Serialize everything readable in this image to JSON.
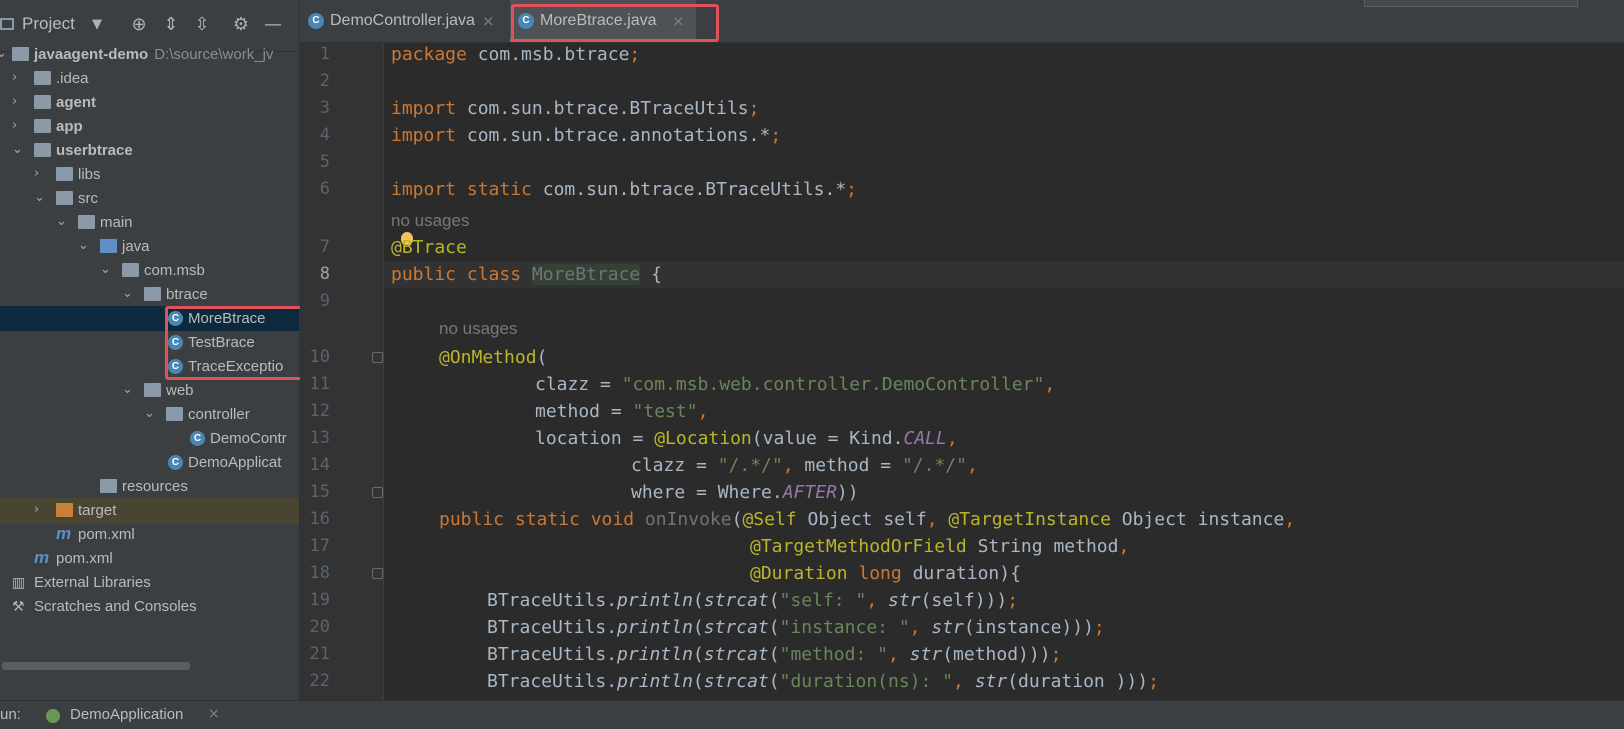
{
  "project_panel": {
    "title": "Project",
    "tree": {
      "root": {
        "label": "javaagent-demo",
        "path": "D:\\source\\work_jv"
      },
      "idea": ".idea",
      "agent": "agent",
      "app": "app",
      "userbtrace": "userbtrace",
      "libs": "libs",
      "src": "src",
      "main": "main",
      "java": "java",
      "com_msb": "com.msb",
      "btrace": "btrace",
      "more_btrace": "MoreBtrace",
      "test_brace": "TestBrace",
      "trace_exception": "TraceExceptio",
      "web": "web",
      "controller": "controller",
      "demo_controller": "DemoContr",
      "demo_application": "DemoApplicat",
      "resources": "resources",
      "target": "target",
      "pom_inner": "pom.xml",
      "pom_root": "pom.xml",
      "external_libraries": "External Libraries",
      "scratches": "Scratches and Consoles"
    }
  },
  "tabs": [
    {
      "label": "DemoController.java"
    },
    {
      "label": "MoreBtrace.java",
      "active": true
    }
  ],
  "editor": {
    "line_numbers": [
      "1",
      "2",
      "3",
      "4",
      "5",
      "6",
      "7",
      "8",
      "9",
      "10",
      "11",
      "12",
      "13",
      "14",
      "15",
      "16",
      "17",
      "18",
      "19",
      "20",
      "21",
      "22"
    ],
    "current_line": "8",
    "hints": {
      "no_usages_1": "no usages",
      "no_usages_2": "no usages"
    },
    "code": {
      "l1_kw": "package",
      "l1_rest": " com.msb.btrace",
      "l1_semi": ";",
      "l3_kw": "import",
      "l3_rest": " com.sun.btrace.BTraceUtils",
      "l3_semi": ";",
      "l4_kw": "import",
      "l4_rest": " com.sun.btrace.annotations.*",
      "l4_semi": ";",
      "l6_kw": "import static",
      "l6_rest": " com.sun.btrace.BTraceUtils.*",
      "l6_semi": ";",
      "l7_ann": "@BTrace",
      "l8_kw": "public class ",
      "l8_cls": "MoreBtrace",
      "l8_rest": " {",
      "l10_ann": "@OnMethod",
      "l10_rest": "(",
      "l11_a": "clazz = ",
      "l11_str": "\"com.msb.web.controller.DemoController\"",
      "l11_semi": ",",
      "l12_a": "method = ",
      "l12_str": "\"test\"",
      "l12_semi": ",",
      "l13_a": "location = ",
      "l13_ann": "@Location",
      "l13_b": "(value = Kind.",
      "l13_const": "CALL",
      "l13_semi": ",",
      "l14_a": "clazz = ",
      "l14_str1": "\"/.*/\"",
      "l14_semi1": ",",
      "l14_b": " method = ",
      "l14_str2": "\"/.*/\"",
      "l14_semi2": ",",
      "l15_a": "where = Where.",
      "l15_const": "AFTER",
      "l15_b": "))",
      "l16_kw": "public static void ",
      "l16_fn": "onInvoke",
      "l16_b": "(",
      "l16_ann1": "@Self",
      "l16_c": " Object self",
      "l16_semi1": ",",
      "l16_ann2": " @TargetInstance",
      "l16_d": " Object instance",
      "l16_semi2": ",",
      "l17_ann": "@TargetMethodOrField",
      "l17_a": " String method",
      "l17_semi": ",",
      "l18_ann": "@Duration",
      "l18_kw": " long",
      "l18_a": " duration){",
      "l19_a": "BTraceUtils.",
      "l19_m": "println",
      "l19_b": "(",
      "l19_m2": "strcat",
      "l19_c": "(",
      "l19_str": "\"self: \"",
      "l19_semi": ",",
      "l19_m3": " str",
      "l19_d": "(self)))",
      "l19_end": ";",
      "l20_a": "BTraceUtils.",
      "l20_m": "println",
      "l20_b": "(",
      "l20_m2": "strcat",
      "l20_c": "(",
      "l20_str": "\"instance: \"",
      "l20_semi": ",",
      "l20_m3": " str",
      "l20_d": "(instance)))",
      "l20_end": ";",
      "l21_a": "BTraceUtils.",
      "l21_m": "println",
      "l21_b": "(",
      "l21_m2": "strcat",
      "l21_c": "(",
      "l21_str": "\"method: \"",
      "l21_semi": ",",
      "l21_m3": " str",
      "l21_d": "(method)))",
      "l21_end": ";",
      "l22_a": "BTraceUtils.",
      "l22_m": "println",
      "l22_b": "(",
      "l22_m2": "strcat",
      "l22_c": "(",
      "l22_str": "\"duration(ns): \"",
      "l22_semi": ",",
      "l22_m3": " str",
      "l22_d": "(duration )))",
      "l22_end": ";"
    }
  },
  "bottom_bar": {
    "run_label": "un:",
    "run_config": "DemoApplication"
  },
  "colors": {
    "highlight_box": "#e0515a",
    "keyword": "#cc7832",
    "annotation": "#bbb529",
    "string": "#6a8759",
    "constant": "#9876aa"
  }
}
